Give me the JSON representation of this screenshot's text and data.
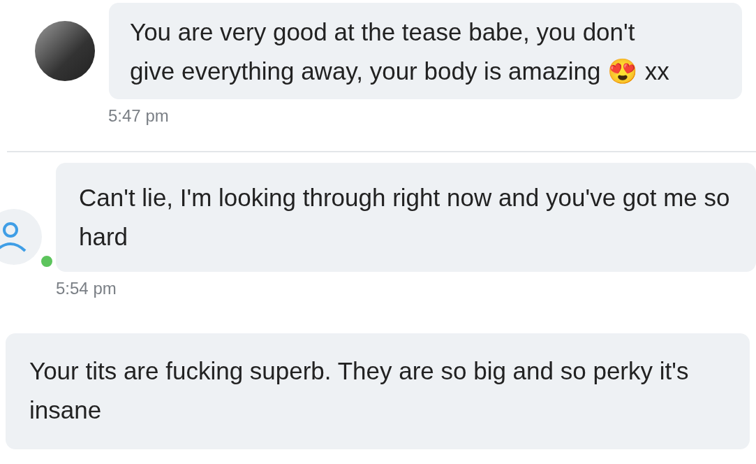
{
  "messages": [
    {
      "kind": "photo",
      "online": false,
      "text": "You are very good at the tease babe, you don't give everything away, your body is amazing 😍 xx",
      "time": "5:47 pm",
      "divider_after": true
    },
    {
      "kind": "default",
      "online": true,
      "text": "Can't lie, I'm looking through right now and you've got me so hard",
      "time": "5:54 pm",
      "divider_after": false
    },
    {
      "kind": "plain",
      "online": false,
      "text": "Your tits are fucking superb. They are so big and so perky it's insane",
      "divider_after": false
    }
  ]
}
